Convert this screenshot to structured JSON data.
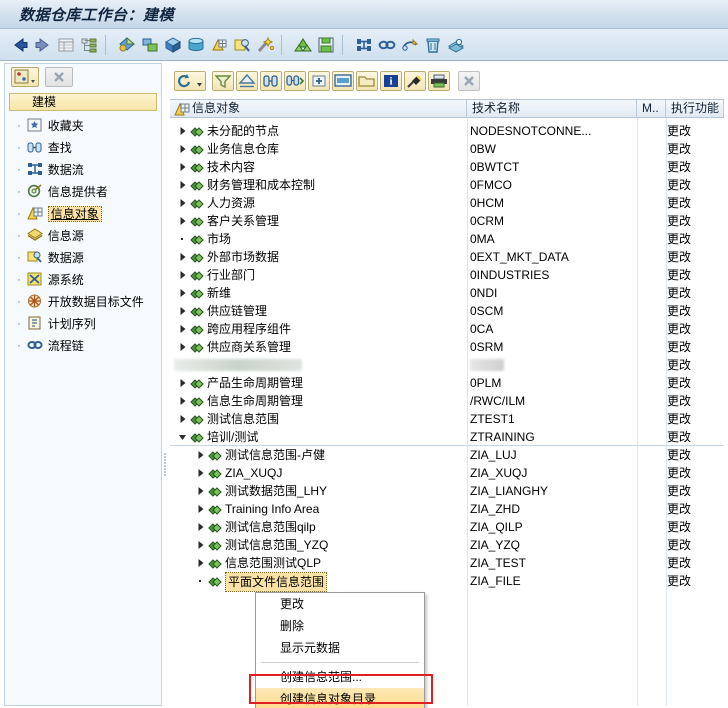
{
  "window": {
    "title": "数据仓库工作台：建模"
  },
  "main_toolbar": {
    "buttons": [
      {
        "name": "back-icon",
        "label": "后退"
      },
      {
        "name": "forward-icon",
        "label": "前进"
      },
      {
        "name": "list-view-icon",
        "label": "列表"
      },
      {
        "name": "tree-view-icon",
        "label": "树"
      },
      {
        "name": "infoprovider-icon",
        "label": "信息提供者"
      },
      {
        "name": "datastore-icon",
        "label": "数据存储对象"
      },
      {
        "name": "infocube-icon",
        "label": "信息立方体"
      },
      {
        "name": "database-icon",
        "label": "数据库"
      },
      {
        "name": "infoobject-icon",
        "label": "信息对象"
      },
      {
        "name": "datasource-icon",
        "label": "数据源"
      },
      {
        "name": "transformation-icon",
        "label": "转换"
      },
      {
        "name": "aggregate-icon",
        "label": "聚集"
      },
      {
        "name": "save-icon",
        "label": "保存"
      },
      {
        "name": "dataflow-icon",
        "label": "数据流"
      },
      {
        "name": "process-chain-icon",
        "label": "流程链"
      },
      {
        "name": "monitor-icon",
        "label": "监视器"
      },
      {
        "name": "delete-icon",
        "label": "删除"
      },
      {
        "name": "admin-icon",
        "label": "管理"
      }
    ]
  },
  "left_panel": {
    "toolbar": [
      {
        "name": "navigation-mode-icon",
        "label": "导航模式"
      },
      {
        "name": "close-panel-icon",
        "label": "关闭"
      }
    ],
    "header": "建模",
    "items": [
      {
        "icon": "favorites-icon",
        "label": "收藏夹",
        "selected": false
      },
      {
        "icon": "search-icon",
        "label": "查找",
        "selected": false
      },
      {
        "icon": "dataflow-icon",
        "label": "数据流",
        "selected": false
      },
      {
        "icon": "infoprovider-icon",
        "label": "信息提供者",
        "selected": false
      },
      {
        "icon": "infoobject-icon",
        "label": "信息对象",
        "selected": true
      },
      {
        "icon": "infosource-icon",
        "label": "信息源",
        "selected": false
      },
      {
        "icon": "datasource-icon",
        "label": "数据源",
        "selected": false
      },
      {
        "icon": "sourcesystem-icon",
        "label": "源系统",
        "selected": false
      },
      {
        "icon": "opendhub-icon",
        "label": "开放数据目标文件",
        "selected": false
      },
      {
        "icon": "planning-icon",
        "label": "计划序列",
        "selected": false
      },
      {
        "icon": "processchain-icon",
        "label": "流程链",
        "selected": false
      }
    ]
  },
  "right_panel": {
    "toolbar": [
      {
        "name": "refresh-icon",
        "label": "刷新",
        "dropdown": true,
        "disabled": false
      },
      {
        "name": "filter-icon",
        "label": "过滤",
        "dropdown": false,
        "disabled": false
      },
      {
        "name": "sort-icon",
        "label": "排序",
        "dropdown": false,
        "disabled": false
      },
      {
        "name": "find-icon",
        "label": "查找",
        "dropdown": false,
        "disabled": false
      },
      {
        "name": "find-next-icon",
        "label": "查找下一个",
        "dropdown": false,
        "disabled": false
      },
      {
        "name": "expand-all-icon",
        "label": "全部展开",
        "dropdown": false,
        "disabled": false
      },
      {
        "name": "display-icon",
        "label": "显示",
        "dropdown": false,
        "disabled": false
      },
      {
        "name": "folder-icon",
        "label": "文件夹",
        "dropdown": false,
        "disabled": false
      },
      {
        "name": "info-icon",
        "label": "信息",
        "dropdown": false,
        "disabled": false
      },
      {
        "name": "pin-icon",
        "label": "固定",
        "dropdown": false,
        "disabled": false
      },
      {
        "name": "print-icon",
        "label": "打印",
        "dropdown": false,
        "disabled": false
      },
      {
        "name": "close-icon",
        "label": "关闭",
        "dropdown": false,
        "disabled": true
      }
    ],
    "columns": [
      {
        "key": "name",
        "label": "信息对象"
      },
      {
        "key": "tech",
        "label": "技术名称"
      },
      {
        "key": "m",
        "label": "M.."
      },
      {
        "key": "act",
        "label": "执行功能"
      }
    ],
    "rows": [
      {
        "label": "未分配的节点",
        "tech": "NODESNOTCONNE...",
        "act": "更改",
        "depth": 0,
        "expander": "collapsed"
      },
      {
        "label": "业务信息仓库",
        "tech": "0BW",
        "act": "更改",
        "depth": 0,
        "expander": "collapsed"
      },
      {
        "label": "技术内容",
        "tech": "0BWTCT",
        "act": "更改",
        "depth": 0,
        "expander": "collapsed"
      },
      {
        "label": "财务管理和成本控制",
        "tech": "0FMCO",
        "act": "更改",
        "depth": 0,
        "expander": "collapsed"
      },
      {
        "label": "人力资源",
        "tech": "0HCM",
        "act": "更改",
        "depth": 0,
        "expander": "collapsed"
      },
      {
        "label": "客户关系管理",
        "tech": "0CRM",
        "act": "更改",
        "depth": 0,
        "expander": "collapsed"
      },
      {
        "label": "市场",
        "tech": "0MA",
        "act": "更改",
        "depth": 0,
        "expander": "leaf"
      },
      {
        "label": "外部市场数据",
        "tech": "0EXT_MKT_DATA",
        "act": "更改",
        "depth": 0,
        "expander": "collapsed"
      },
      {
        "label": "行业部门",
        "tech": "0INDUSTRIES",
        "act": "更改",
        "depth": 0,
        "expander": "collapsed"
      },
      {
        "label": "新维",
        "tech": "0NDI",
        "act": "更改",
        "depth": 0,
        "expander": "collapsed"
      },
      {
        "label": "供应链管理",
        "tech": "0SCM",
        "act": "更改",
        "depth": 0,
        "expander": "collapsed"
      },
      {
        "label": "跨应用程序组件",
        "tech": "0CA",
        "act": "更改",
        "depth": 0,
        "expander": "collapsed"
      },
      {
        "label": "供应商关系管理",
        "tech": "0SRM",
        "act": "更改",
        "depth": 0,
        "expander": "collapsed"
      },
      {
        "label": "",
        "tech": "",
        "act": "更改",
        "depth": 0,
        "expander": "none",
        "redacted": true
      },
      {
        "label": "产品生命周期管理",
        "tech": "0PLM",
        "act": "更改",
        "depth": 0,
        "expander": "collapsed"
      },
      {
        "label": "信息生命周期管理",
        "tech": "/RWC/ILM",
        "act": "更改",
        "depth": 0,
        "expander": "collapsed"
      },
      {
        "label": "测试信息范围",
        "tech": "ZTEST1",
        "act": "更改",
        "depth": 0,
        "expander": "collapsed"
      },
      {
        "label": "培训/测试",
        "tech": "ZTRAINING",
        "act": "更改",
        "depth": 0,
        "expander": "expanded"
      },
      {
        "label": "测试信息范围-卢健",
        "tech": "ZIA_LUJ",
        "act": "更改",
        "depth": 1,
        "expander": "collapsed"
      },
      {
        "label": "ZIA_XUQJ",
        "tech": "ZIA_XUQJ",
        "act": "更改",
        "depth": 1,
        "expander": "collapsed"
      },
      {
        "label": "测试数据范围_LHY",
        "tech": "ZIA_LIANGHY",
        "act": "更改",
        "depth": 1,
        "expander": "collapsed"
      },
      {
        "label": "Training Info Area",
        "tech": "ZIA_ZHD",
        "act": "更改",
        "depth": 1,
        "expander": "collapsed"
      },
      {
        "label": "测试信息范围qilp",
        "tech": "ZIA_QILP",
        "act": "更改",
        "depth": 1,
        "expander": "collapsed"
      },
      {
        "label": "测试信息范围_YZQ",
        "tech": "ZIA_YZQ",
        "act": "更改",
        "depth": 1,
        "expander": "collapsed"
      },
      {
        "label": "信息范围测试QLP",
        "tech": "ZIA_TEST",
        "act": "更改",
        "depth": 1,
        "expander": "collapsed"
      },
      {
        "label": "平面文件信息范围",
        "tech": "ZIA_FILE",
        "act": "更改",
        "depth": 1,
        "expander": "leaf",
        "selected": true
      }
    ]
  },
  "context_menu": {
    "items": [
      {
        "label": "更改",
        "separator_after": false,
        "highlighted": false
      },
      {
        "label": "删除",
        "separator_after": false,
        "highlighted": false
      },
      {
        "label": "显示元数据",
        "separator_after": true,
        "highlighted": false
      },
      {
        "label": "创建信息范围...",
        "separator_after": false,
        "highlighted": false
      },
      {
        "label": "创建信息对象目录",
        "separator_after": false,
        "highlighted": true
      }
    ]
  },
  "colors": {
    "title_bar": "#d6e3ef",
    "accent_yellow": "#f6e6a8",
    "selection": "#fbe3a8",
    "highlight_box": "#e02020",
    "node_green": "#3f8f3f"
  }
}
